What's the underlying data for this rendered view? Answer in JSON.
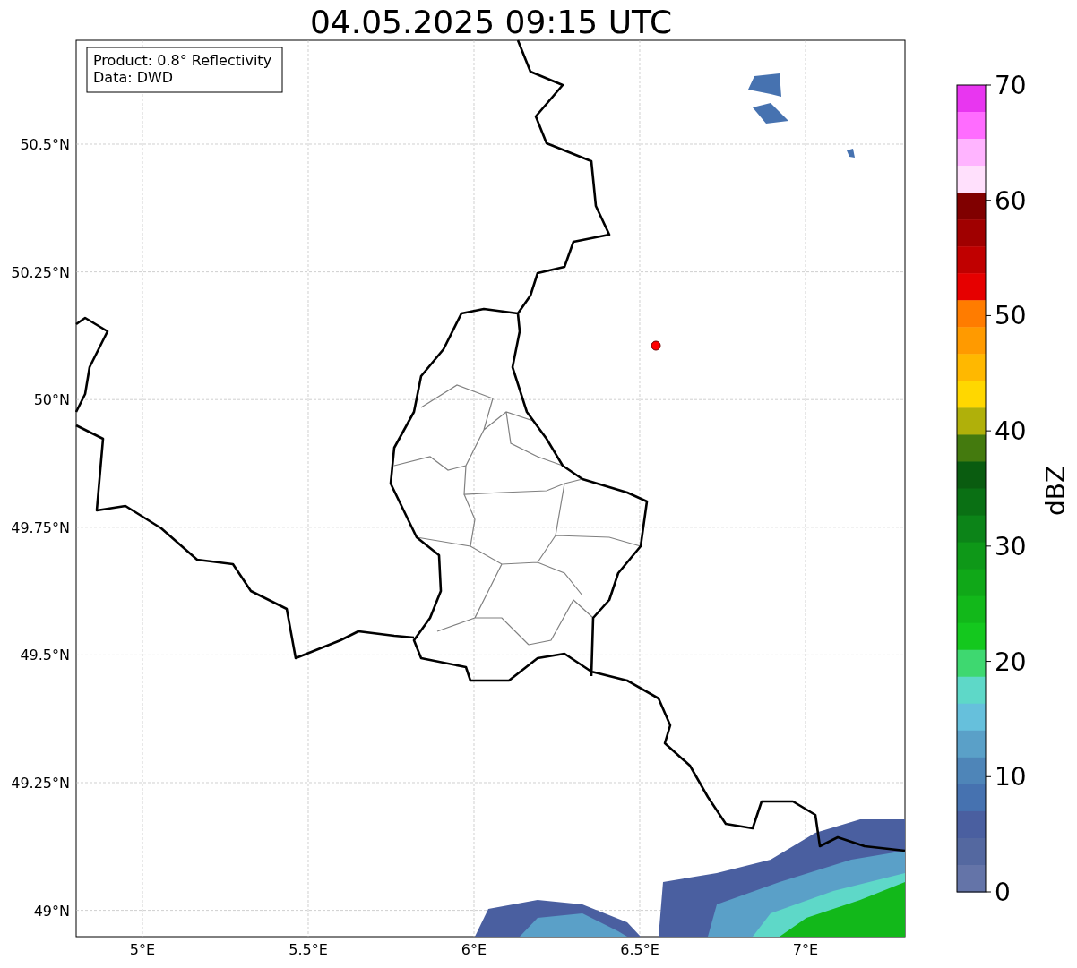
{
  "title": "04.05.2025 09:15 UTC",
  "info_lines": [
    "Product: 0.8° Reflectivity",
    "Data: DWD"
  ],
  "lon_ticks": [
    "5°E",
    "5.5°E",
    "6°E",
    "6.5°E",
    "7°E"
  ],
  "lat_ticks": [
    "50.5°N",
    "50.25°N",
    "50°N",
    "49.75°N",
    "49.5°N",
    "49.25°N",
    "49°N"
  ],
  "colorbar": {
    "label": "dBZ",
    "ticks": [
      "70",
      "60",
      "50",
      "40",
      "30",
      "20",
      "10",
      "0"
    ],
    "segments": [
      {
        "color": "#e836f0"
      },
      {
        "color": "#ff6cff"
      },
      {
        "color": "#ffb4ff"
      },
      {
        "color": "#ffe0fc"
      },
      {
        "color": "#800000"
      },
      {
        "color": "#a00000"
      },
      {
        "color": "#c00000"
      },
      {
        "color": "#e60000"
      },
      {
        "color": "#ff7c00"
      },
      {
        "color": "#ff9a00"
      },
      {
        "color": "#ffb800"
      },
      {
        "color": "#ffd700"
      },
      {
        "color": "#b0b00a"
      },
      {
        "color": "#447a0e"
      },
      {
        "color": "#0a5c10"
      },
      {
        "color": "#0a7014"
      },
      {
        "color": "#0c8418"
      },
      {
        "color": "#0e9818"
      },
      {
        "color": "#10a818"
      },
      {
        "color": "#12b81a"
      },
      {
        "color": "#14c81e"
      },
      {
        "color": "#3ed870"
      },
      {
        "color": "#5ed8c8"
      },
      {
        "color": "#66c0dc"
      },
      {
        "color": "#5aa0c8"
      },
      {
        "color": "#4e85b8"
      },
      {
        "color": "#4672b0"
      },
      {
        "color": "#4a5fa0"
      },
      {
        "color": "#5468a0"
      },
      {
        "color": "#6474a8"
      }
    ]
  }
}
